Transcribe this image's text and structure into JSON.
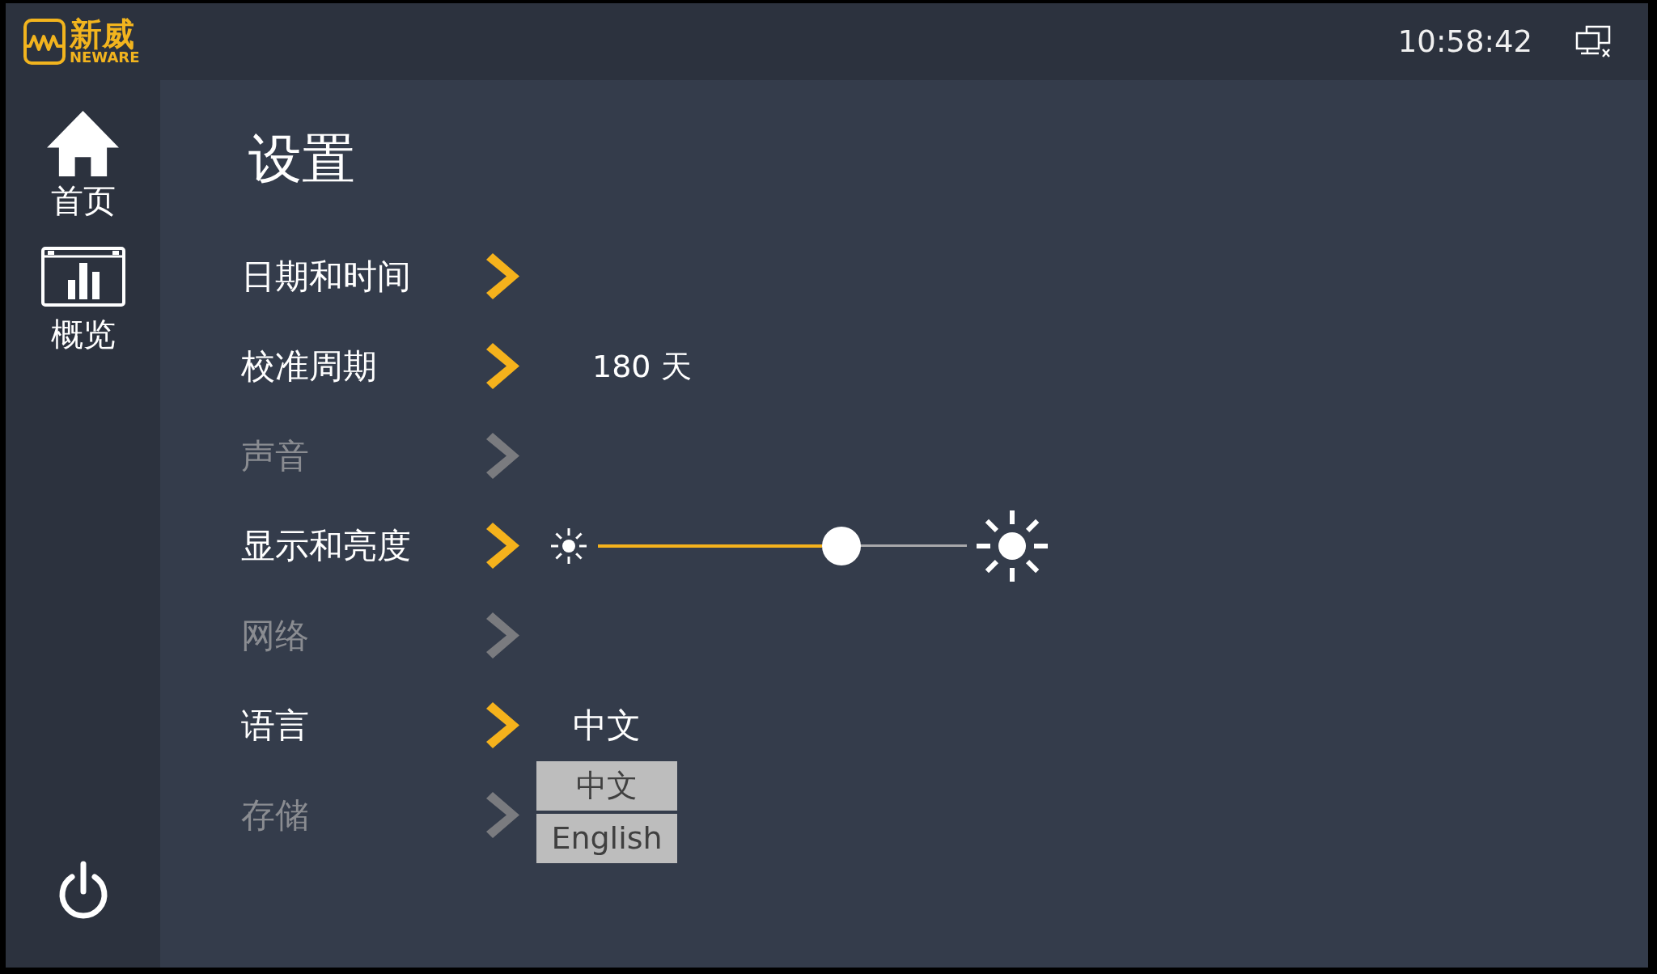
{
  "header": {
    "logo": {
      "title": "新威",
      "subtitle": "NEWARE"
    },
    "time": "10:58:42"
  },
  "sidebar": {
    "items": [
      {
        "kind": "home",
        "label": "首页"
      },
      {
        "kind": "overview",
        "label": "概览"
      }
    ]
  },
  "settings": {
    "title": "设置",
    "items": [
      {
        "kind": "link",
        "label": "日期和时间",
        "disabled": false
      },
      {
        "kind": "value",
        "label": "校准周期",
        "disabled": false,
        "value": "180 天"
      },
      {
        "kind": "link",
        "label": "声音",
        "disabled": true
      },
      {
        "kind": "slider",
        "label": "显示和亮度",
        "disabled": false,
        "level": 0.66
      },
      {
        "kind": "link",
        "label": "网络",
        "disabled": true
      },
      {
        "kind": "dropdown",
        "label": "语言",
        "disabled": false,
        "value": "中文",
        "expanded": true,
        "options": [
          {
            "label": "中文"
          },
          {
            "label": "English"
          }
        ]
      },
      {
        "kind": "link",
        "label": "存储",
        "disabled": true
      }
    ]
  }
}
